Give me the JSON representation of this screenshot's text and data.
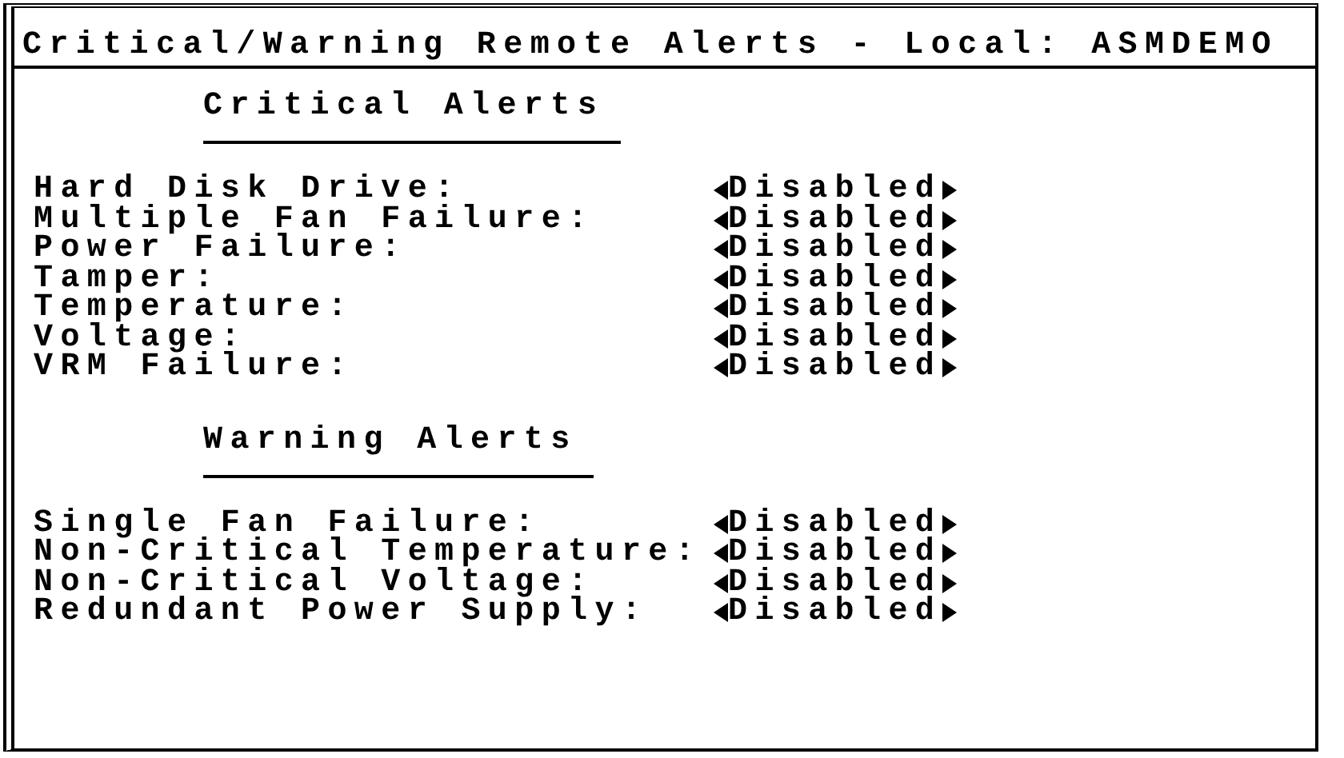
{
  "window": {
    "title": "Critical/Warning Remote Alerts - Local: ASMDEMO"
  },
  "sections": [
    {
      "heading": "Critical Alerts",
      "items": [
        {
          "label": "Hard Disk Drive:",
          "value": "Disabled"
        },
        {
          "label": "Multiple Fan Failure:",
          "value": "Disabled"
        },
        {
          "label": "Power Failure:",
          "value": "Disabled"
        },
        {
          "label": "Tamper:",
          "value": "Disabled"
        },
        {
          "label": "Temperature:",
          "value": "Disabled"
        },
        {
          "label": "Voltage:",
          "value": "Disabled"
        },
        {
          "label": "VRM Failure:",
          "value": "Disabled"
        }
      ]
    },
    {
      "heading": "Warning Alerts",
      "items": [
        {
          "label": "Single Fan Failure:",
          "value": "Disabled"
        },
        {
          "label": "Non-Critical Temperature:",
          "value": "Disabled"
        },
        {
          "label": "Non-Critical Voltage:",
          "value": "Disabled"
        },
        {
          "label": "Redundant Power Supply:",
          "value": "Disabled"
        }
      ]
    }
  ]
}
